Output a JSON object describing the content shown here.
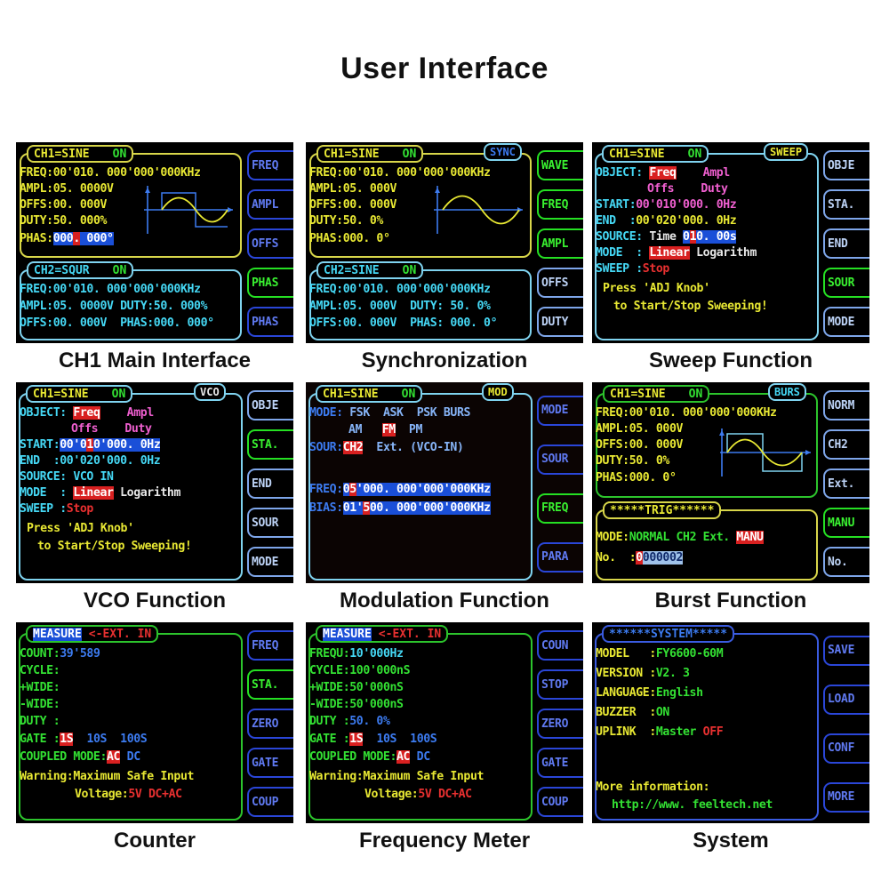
{
  "page": {
    "title": "User Interface"
  },
  "panels": [
    {
      "id": "ch1-main",
      "caption": "CH1 Main Interface",
      "ch1": {
        "header_left": "CH1=SINE",
        "header_on": "ON",
        "lines": [
          {
            "label": "FREQ:",
            "value": "00'010. 000'000'000KHz"
          },
          {
            "label": "AMPL:",
            "value": "05. 0000V"
          },
          {
            "label": "OFFS:",
            "value": "00. 000V"
          },
          {
            "label": "DUTY:",
            "value": "50. 000%"
          },
          {
            "label": "PHAS:",
            "value_a": "000",
            "value_cursor": ".",
            "value_b": " 000°"
          }
        ]
      },
      "ch2": {
        "header_left": "CH2=SQUR",
        "header_on": "ON",
        "lines": [
          "FREQ:00'010. 000'000'000KHz",
          "AMPL:05. 0000V DUTY:50. 000%",
          "OFFS:00. 000V  PHAS:000. 000°"
        ]
      },
      "buttons": [
        {
          "label": "FREQ",
          "active": false
        },
        {
          "label": "AMPL",
          "active": false
        },
        {
          "label": "OFFS",
          "active": false
        },
        {
          "label": "PHAS",
          "active": true
        },
        {
          "label": "PHAS",
          "active": false
        }
      ]
    },
    {
      "id": "synchronization",
      "caption": "Synchronization",
      "ch1": {
        "header_left": "CH1=SINE",
        "header_on": "ON",
        "tag": "SYNC",
        "lines": [
          {
            "label": "FREQ:",
            "value": "00'010. 000'000'000KHz"
          },
          {
            "label": "AMPL:",
            "value": "05. 000V"
          },
          {
            "label": "OFFS:",
            "value": "00. 000V"
          },
          {
            "label": "DUTY:",
            "value": "50. 0%"
          },
          {
            "label": "PHAS:",
            "value": "000. 0°"
          }
        ]
      },
      "ch2": {
        "header_left": "CH2=SINE",
        "header_on": "ON",
        "lines": [
          "FREQ:00'010. 000'000'000KHz",
          "AMPL:05. 000V  DUTY: 50. 0%",
          "OFFS:00. 000V  PHAS: 000. 0°"
        ]
      },
      "buttons": [
        {
          "label": "WAVE",
          "active": true
        },
        {
          "label": "FREQ",
          "active": true
        },
        {
          "label": "AMPL",
          "active": true
        },
        {
          "label": "OFFS",
          "active": false
        },
        {
          "label": "DUTY",
          "active": false
        }
      ]
    },
    {
      "id": "sweep",
      "caption": "Sweep Function",
      "header_left": "CH1=SINE",
      "header_on": "ON",
      "tag": "SWEEP",
      "rows": {
        "object_label": "OBJECT:",
        "object_sel": "Freq",
        "object_opt2": "Ampl",
        "object_opt3": "Offs",
        "object_opt4": "Duty",
        "start_label": "START:",
        "start_value": "00'010'000. 0Hz",
        "end_label": "END  :",
        "end_value": "00'020'000. 0Hz",
        "source_label": "SOURCE:",
        "source_word": "Time",
        "source_value_a": "0",
        "source_value_cursor": "1",
        "source_value_b": "0. 00s",
        "mode_label": "MODE  :",
        "mode_sel": "Linear",
        "mode_opt2": "Logarithm",
        "sweep_label": "SWEEP :",
        "sweep_value": "Stop",
        "hint1": "Press 'ADJ Knob'",
        "hint2": "to Start/Stop Sweeping!"
      },
      "buttons": [
        {
          "label": "OBJE",
          "active": false
        },
        {
          "label": "STA.",
          "active": false
        },
        {
          "label": "END",
          "active": false
        },
        {
          "label": "SOUR",
          "active": true
        },
        {
          "label": "MODE",
          "active": false
        }
      ]
    },
    {
      "id": "vco",
      "caption": "VCO Function",
      "header_left": "CH1=SINE",
      "header_on": "ON",
      "tag": "VCO",
      "rows": {
        "object_label": "OBJECT:",
        "object_sel": "Freq",
        "object_opt2": "Ampl",
        "object_opt3": "Offs",
        "object_opt4": "Duty",
        "start_label": "START:",
        "start_value_a": "00'0",
        "start_value_cursor": "1",
        "start_value_b": "0'000. 0Hz",
        "end_label": "END  :",
        "end_value": "00'020'000. 0Hz",
        "source_label": "SOURCE:",
        "source_value": "VCO IN",
        "mode_label": "MODE  :",
        "mode_sel": "Linear",
        "mode_opt2": "Logarithm",
        "sweep_label": "SWEEP :",
        "sweep_value": "Stop",
        "hint1": "Press 'ADJ Knob'",
        "hint2": "to Start/Stop Sweeping!"
      },
      "buttons": [
        {
          "label": "OBJE",
          "active": false
        },
        {
          "label": "STA.",
          "active": true
        },
        {
          "label": "END",
          "active": false
        },
        {
          "label": "SOUR",
          "active": false
        },
        {
          "label": "MODE",
          "active": false
        }
      ]
    },
    {
      "id": "modulation",
      "caption": "Modulation Function",
      "header_left": "CH1=SINE",
      "header_on": "ON",
      "tag": "MOD",
      "rows": {
        "mode_label": "MODE:",
        "mode_opts_row1": [
          "FSK",
          "ASK",
          "PSK",
          "BURS"
        ],
        "mode_opts_row2": [
          "AM",
          "FM",
          "PM"
        ],
        "mode_selected": "FM",
        "sour_label": "SOUR:",
        "sour_sel": "CH2",
        "sour_opt2": "Ext. (VCO-IN)",
        "freq_label": "FREQ:",
        "freq_a": "0",
        "freq_cursor": "5",
        "freq_b": "'000. 000'000'000KHz",
        "bias_label": "BIAS:",
        "bias_a": "01'",
        "bias_cursor": "5",
        "bias_b": "00. 000'000'000KHz"
      },
      "buttons": [
        {
          "label": "MODE",
          "active": false
        },
        {
          "label": "SOUR",
          "active": false
        },
        {
          "label": "FREQ",
          "active": true
        },
        {
          "label": "PARA",
          "active": false
        }
      ]
    },
    {
      "id": "burst",
      "caption": "Burst Function",
      "header_left": "CH1=SINE",
      "header_on": "ON",
      "tag": "BURS",
      "ch1": {
        "lines": [
          {
            "label": "FREQ:",
            "value": "00'010. 000'000'000KHz"
          },
          {
            "label": "AMPL:",
            "value": "05. 000V"
          },
          {
            "label": "OFFS:",
            "value": "00. 000V"
          },
          {
            "label": "DUTY:",
            "value": "50. 0%"
          },
          {
            "label": "PHAS:",
            "value": "000. 0°"
          }
        ]
      },
      "trig": {
        "header": "*****TRIG******",
        "mode_label": "MODE:",
        "mode_opts": [
          "NORMAL",
          "CH2",
          "Ext."
        ],
        "mode_selected": "MANU",
        "no_label": "No.  :",
        "no_cursor": "0",
        "no_value": "000002"
      },
      "buttons": [
        {
          "label": "NORM",
          "active": false
        },
        {
          "label": "CH2",
          "active": false
        },
        {
          "label": "Ext.",
          "active": false
        },
        {
          "label": "MANU",
          "active": true
        },
        {
          "label": "No.",
          "active": false
        }
      ]
    },
    {
      "id": "counter",
      "caption": "Counter",
      "header_a": "MEASURE",
      "header_b": "<-EXT. IN",
      "rows": [
        {
          "label": "COUNT:",
          "value": "39'589",
          "vclass": "b"
        },
        {
          "label": "CYCLE:",
          "value": "",
          "vclass": "b"
        },
        {
          "label": "+WIDE:",
          "value": "",
          "vclass": "b"
        },
        {
          "label": "-WIDE:",
          "value": "",
          "vclass": "b"
        },
        {
          "label": "DUTY :",
          "value": "",
          "vclass": "b"
        }
      ],
      "gate_label": "GATE :",
      "gate_sel": "1S",
      "gate_opts": [
        "10S",
        "100S"
      ],
      "coupled_label": "COUPLED MODE:",
      "coupled_sel": "AC",
      "coupled_opt": "DC",
      "warn1": "Warning:Maximum Safe Input",
      "warn2_a": "Voltage:",
      "warn2_b": "5V DC+AC",
      "buttons": [
        {
          "label": "FREQ",
          "active": false
        },
        {
          "label": "STA.",
          "active": true
        },
        {
          "label": "ZERO",
          "active": false
        },
        {
          "label": "GATE",
          "active": false
        },
        {
          "label": "COUP",
          "active": false
        }
      ]
    },
    {
      "id": "frequency-meter",
      "caption": "Frequency Meter",
      "header_a": "MEASURE",
      "header_b": "<-EXT. IN",
      "rows": [
        {
          "label": "FREQU:",
          "value": "10'000Hz",
          "vclass": "c"
        },
        {
          "label": "CYCLE:",
          "value": "100'000nS",
          "vclass": "g"
        },
        {
          "label": "+WIDE:",
          "value": "50'000nS",
          "vclass": "g"
        },
        {
          "label": "-WIDE:",
          "value": "50'000nS",
          "vclass": "g"
        },
        {
          "label": "DUTY :",
          "value": "50. 0%",
          "vclass": "b"
        }
      ],
      "gate_label": "GATE :",
      "gate_sel": "1S",
      "gate_opts": [
        "10S",
        "100S"
      ],
      "coupled_label": "COUPLED MODE:",
      "coupled_sel": "AC",
      "coupled_opt": "DC",
      "warn1": "Warning:Maximum Safe Input",
      "warn2_a": "Voltage:",
      "warn2_b": "5V DC+AC",
      "buttons": [
        {
          "label": "COUN",
          "active": false
        },
        {
          "label": "STOP",
          "active": false
        },
        {
          "label": "ZERO",
          "active": false
        },
        {
          "label": "GATE",
          "active": false
        },
        {
          "label": "COUP",
          "active": false
        }
      ]
    },
    {
      "id": "system",
      "caption": "System",
      "header": "******SYSTEM*****",
      "rows": [
        {
          "label": "MODEL   :",
          "value": "FY6600-60M"
        },
        {
          "label": "VERSION :",
          "value": "V2. 3"
        },
        {
          "label": "LANGUAGE:",
          "value": "English"
        },
        {
          "label": "BUZZER  :",
          "value": "ON"
        },
        {
          "label": "UPLINK  :",
          "value": "Master",
          "extra": "OFF"
        }
      ],
      "more_info": "More information:",
      "url": "http://www. feeltech.net",
      "buttons": [
        {
          "label": "SAVE",
          "active": false
        },
        {
          "label": "LOAD",
          "active": false
        },
        {
          "label": "CONF",
          "active": false
        },
        {
          "label": "MORE",
          "active": false
        }
      ]
    }
  ],
  "colors": {
    "yellow": "#e8e833",
    "green": "#33e033",
    "cyan": "#45d8f5",
    "blue": "#3c7bf0",
    "red": "#e83030",
    "magenta": "#f05fd0",
    "select_red": "#d82020",
    "select_blue": "#1a4fd8"
  }
}
